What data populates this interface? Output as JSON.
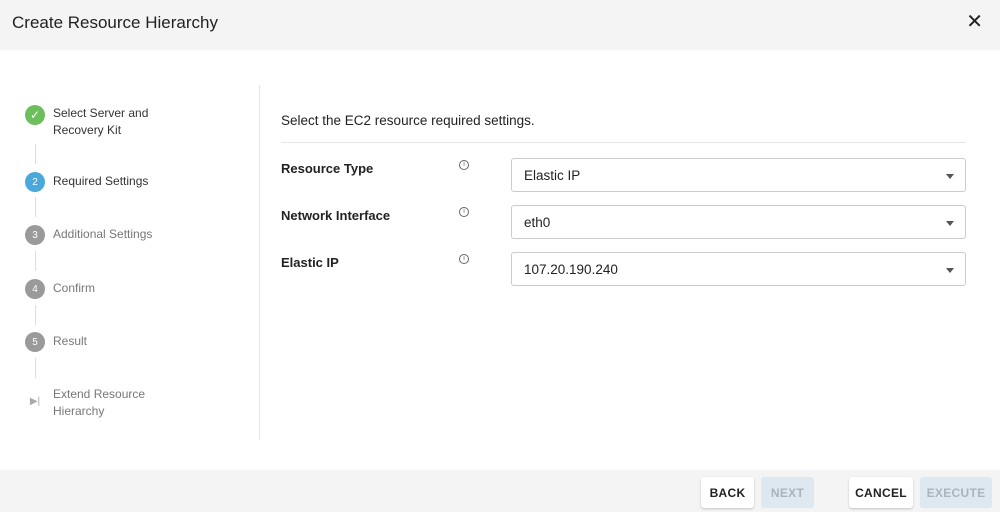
{
  "dialog": {
    "title": "Create Resource Hierarchy"
  },
  "steps": [
    {
      "num": "✓",
      "label": "Select Server and Recovery Kit",
      "state": "done"
    },
    {
      "num": "2",
      "label": "Required Settings",
      "state": "active"
    },
    {
      "num": "3",
      "label": "Additional Settings",
      "state": "pending"
    },
    {
      "num": "4",
      "label": "Confirm",
      "state": "pending"
    },
    {
      "num": "5",
      "label": "Result",
      "state": "pending"
    },
    {
      "num": "▶|",
      "label": "Extend Resource Hierarchy",
      "state": "pending"
    }
  ],
  "main": {
    "intro": "Select the EC2 resource required settings.",
    "fields": [
      {
        "label": "Resource Type",
        "value": "Elastic IP"
      },
      {
        "label": "Network Interface",
        "value": "eth0"
      },
      {
        "label": "Elastic IP",
        "value": "107.20.190.240"
      }
    ]
  },
  "footer": {
    "back": "BACK",
    "next": "NEXT",
    "cancel": "CANCEL",
    "execute": "EXECUTE"
  },
  "colors": {
    "done": "#6cbf5c",
    "active": "#4aa8dc",
    "pending": "#9a9a9a"
  }
}
